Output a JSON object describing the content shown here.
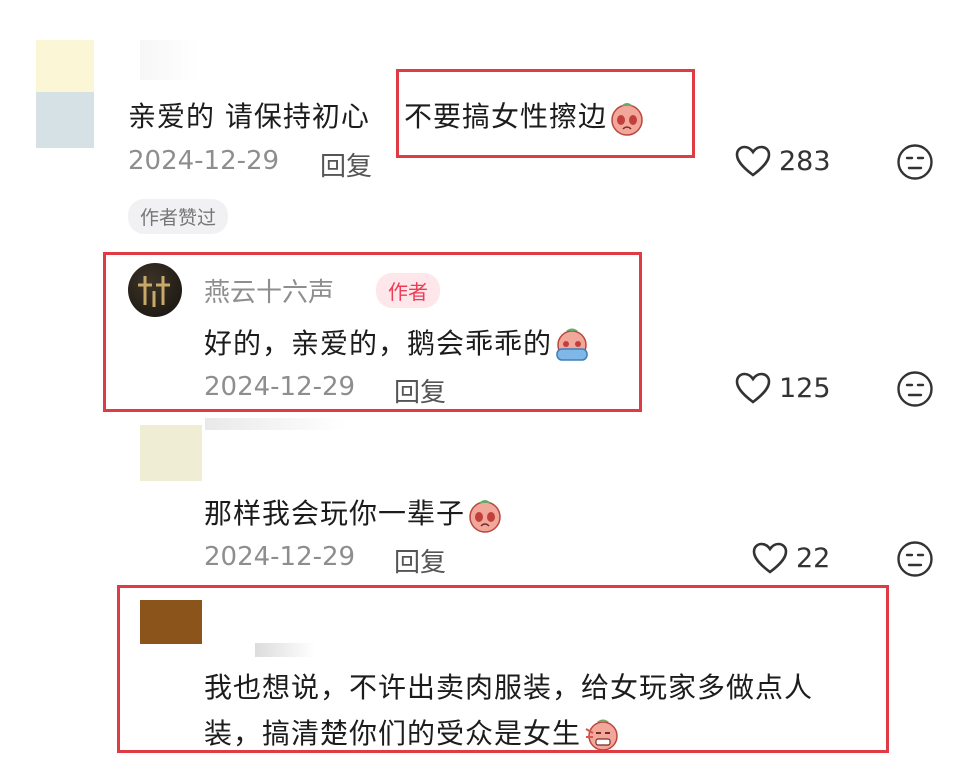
{
  "comments": [
    {
      "text_plain": "亲爱的 请保持初心",
      "text_highlight": "不要搞女性擦边",
      "date": "2024-12-29",
      "reply_label": "回复",
      "likes": "283",
      "badge": "作者赞过"
    },
    {
      "username": "燕云十六声",
      "author_tag": "作者",
      "text": "好的，亲爱的，鹅会乖乖的",
      "date": "2024-12-29",
      "reply_label": "回复",
      "likes": "125"
    },
    {
      "text": "那样我会玩你一辈子",
      "date": "2024-12-29",
      "reply_label": "回复",
      "likes": "22"
    },
    {
      "text_line1": "我也想说，不许出卖肉服装，给女玩家多做点人",
      "text_line2": "装，搞清楚你们的受众是女生"
    }
  ],
  "colors": {
    "highlight_box": "#e03a45",
    "author_badge_bg": "#fde7ea",
    "author_badge_text": "#ee3c55"
  }
}
